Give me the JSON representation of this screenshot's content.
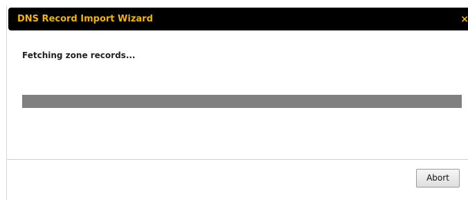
{
  "dialog": {
    "title": "DNS Record Import Wizard",
    "close_glyph": "×",
    "close_icon": "close-icon",
    "status_text": "Fetching zone records...",
    "progress_fraction": 1.0,
    "abort_label": "Abort"
  },
  "colors": {
    "titlebar_bg": "#000000",
    "title_text": "#f5b400",
    "progress_fill": "#808080"
  }
}
